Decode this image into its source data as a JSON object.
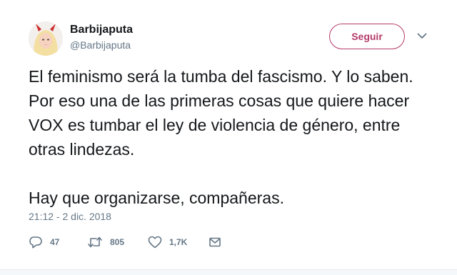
{
  "user": {
    "display_name": "Barbijaputa",
    "handle": "@Barbijaputa"
  },
  "follow_button": {
    "label": "Seguir"
  },
  "tweet": {
    "paragraphs": [
      "El feminismo será la tumba del fascismo. Y lo saben. Por eso una de las primeras cosas que quiere hacer VOX es tumbar el ley de violencia de género, entre otras lindezas.",
      "Hay que organizarse, compañeras."
    ],
    "timestamp": "21:12 - 2 dic. 2018"
  },
  "actions": {
    "replies": "47",
    "retweets": "805",
    "likes": "1,7K"
  },
  "icons": {
    "avatar": "avatar-with-devil-horns",
    "caret": "chevron-down-icon",
    "reply": "reply-icon",
    "retweet": "retweet-icon",
    "like": "heart-icon",
    "message": "envelope-icon"
  },
  "colors": {
    "accent": "#b43b6a",
    "text": "#14171a",
    "muted": "#657786"
  }
}
